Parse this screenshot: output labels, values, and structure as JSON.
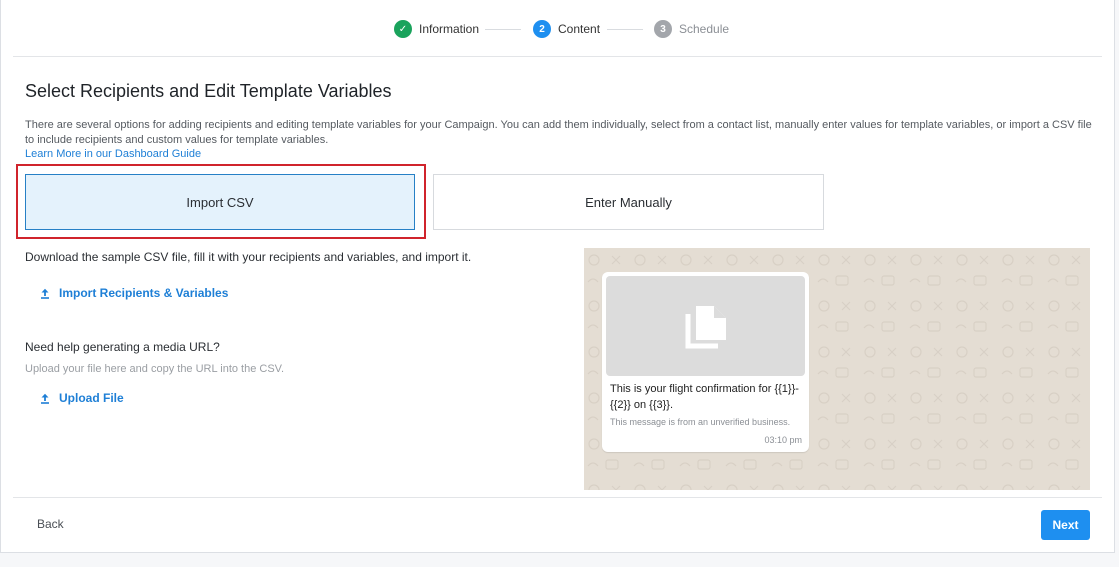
{
  "stepper": {
    "steps": [
      {
        "label": "Information",
        "status": "done",
        "marker": "✓"
      },
      {
        "label": "Content",
        "status": "active",
        "marker": "2"
      },
      {
        "label": "Schedule",
        "status": "pending",
        "marker": "3"
      }
    ]
  },
  "main": {
    "title": "Select Recipients and Edit Template Variables",
    "description": "There are several options for adding recipients and editing template variables for your Campaign. You can add them individually, select from a contact list, manually enter values for template variables, or import a CSV file to include recipients and custom values for template variables.",
    "guide_link": "Learn More in our Dashboard Guide",
    "options": [
      {
        "label": "Import CSV",
        "selected": true
      },
      {
        "label": "Enter Manually",
        "selected": false
      }
    ],
    "sample_text": "Download the sample CSV file, fill it with your recipients and variables, and import it.",
    "import_link": "Import Recipients & Variables",
    "import_icon": "upload-icon",
    "help_title": "Need help generating a media URL?",
    "help_sub": "Upload your file here and copy the URL into the CSV.",
    "upload_link": "Upload File",
    "upload_icon": "upload-icon"
  },
  "preview": {
    "media_icon": "document-icon",
    "message_text": "This is your flight confirmation for {{1}}-{{2}} on {{3}}.",
    "note": "This message is from an unverified business.",
    "time": "03:10 pm"
  },
  "footer": {
    "back_label": "Back",
    "next_label": "Next"
  },
  "colors": {
    "accent": "#1e8ff0",
    "success": "#1aa35c",
    "highlight_border": "#d0242c",
    "selected_bg": "#e4f2fc"
  }
}
